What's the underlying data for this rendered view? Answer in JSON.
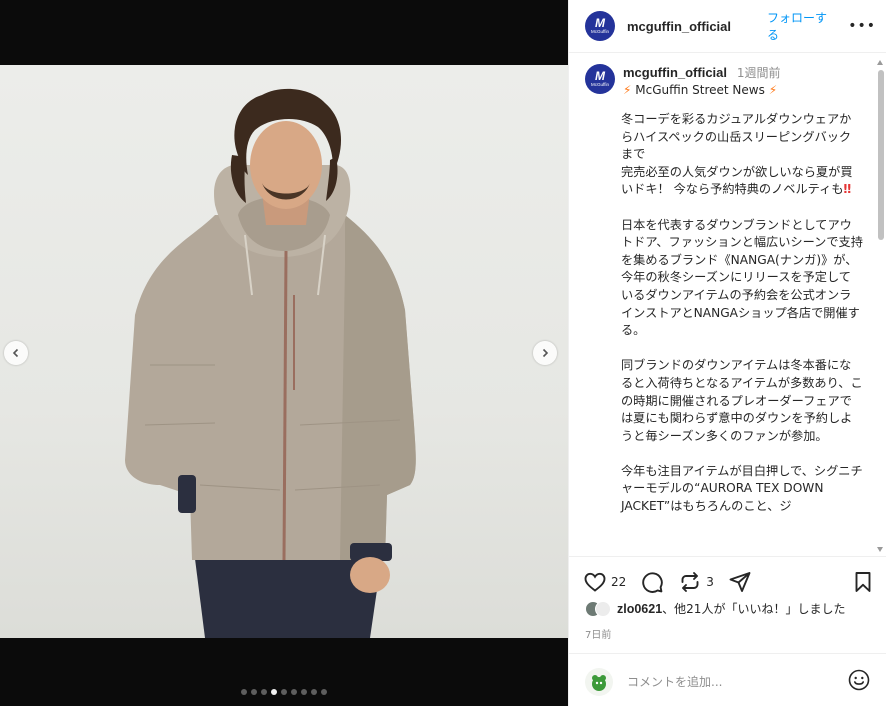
{
  "post": {
    "username": "mcguffin_official",
    "follow_label": "フォローする",
    "more_label": "•••",
    "avatar_text": "M",
    "avatar_subtext": "McGuffin",
    "time_ago": "1週間前",
    "subtitle": "McGuffin Street News",
    "subtitle_icon": "lightning-bolt-icon",
    "caption": [
      "冬コーデを彩るカジュアルダウンウェアからハイスペックの山岳スリーピングバックまで\n完売必至の人気ダウンが欲しいなら夏が買いドキ！ 今なら予約特典のノベルティも",
      "日本を代表するダウンブランドとしてアウトドア、ファッションと幅広いシーンで支持を集めるブランド《NANGA(ナンガ)》が、今年の秋冬シーズンにリリースを予定しているダウンアイテムの予約会を公式オンラインストアとNANGAショップ各店で開催する。",
      " 同ブランドのダウンアイテムは冬本番になると入荷待ちとなるアイテムが多数あり、この時期に開催されるプレオーダーフェアでは夏にも関わらず意中のダウンを予約しようと毎シーズン多くのファンが参加。",
      "今年も注目アイテムが目白押しで、シグニチャーモデルの“AURORA TEX DOWN JACKET”はもちろんのこと、ジ"
    ],
    "caption_emphasis": "‼",
    "likes_count": "22",
    "reposts_count": "3",
    "liked_by_user": "zlo0621",
    "liked_by_text": "、他21人が「いいね！」しました",
    "date": "7日前",
    "comment_placeholder": "コメントを追加...",
    "brand_color": "#24339a"
  },
  "carousel": {
    "total": 9,
    "active_index": 3
  }
}
